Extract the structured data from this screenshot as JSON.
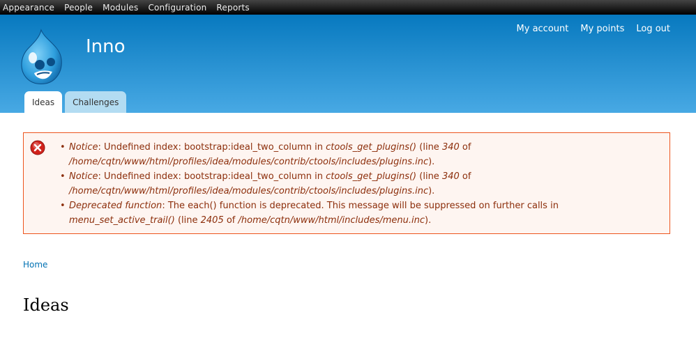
{
  "toolbar": {
    "items": [
      "Appearance",
      "People",
      "Modules",
      "Configuration",
      "Reports"
    ]
  },
  "header": {
    "site_name": "Inno",
    "secondary_menu": [
      "My account",
      "My points",
      "Log out"
    ],
    "tabs": [
      {
        "label": "Ideas",
        "active": true
      },
      {
        "label": "Challenges",
        "active": false
      }
    ]
  },
  "messages": {
    "icon": "error-icon",
    "items": [
      {
        "type": "Notice",
        "text": ": Undefined index: bootstrap:ideal_two_column in ",
        "func": "ctools_get_plugins()",
        "line_pre": " (line ",
        "line": "340",
        "of": " of ",
        "path": "/home/cqtn/www/html/profiles/idea/modules/contrib/ctools/includes/plugins.inc",
        "end": ")."
      },
      {
        "type": "Notice",
        "text": ": Undefined index: bootstrap:ideal_two_column in ",
        "func": "ctools_get_plugins()",
        "line_pre": " (line ",
        "line": "340",
        "of": " of ",
        "path": "/home/cqtn/www/html/profiles/idea/modules/contrib/ctools/includes/plugins.inc",
        "end": ")."
      },
      {
        "type": "Deprecated function",
        "text": ": The each() function is deprecated. This message will be suppressed on further calls in ",
        "func": "menu_set_active_trail()",
        "line_pre": " (line ",
        "line": "2405",
        "of": " of ",
        "path": "/home/cqtn/www/html/includes/menu.inc",
        "end": ")."
      }
    ]
  },
  "breadcrumb": "Home",
  "page_title": "Ideas",
  "colors": {
    "header_top": "#0779bf",
    "header_bottom": "#48a9e4",
    "error_border": "#ed541d",
    "error_bg": "#fef5f1",
    "error_text": "#8c2e0b",
    "link": "#0071b3"
  }
}
